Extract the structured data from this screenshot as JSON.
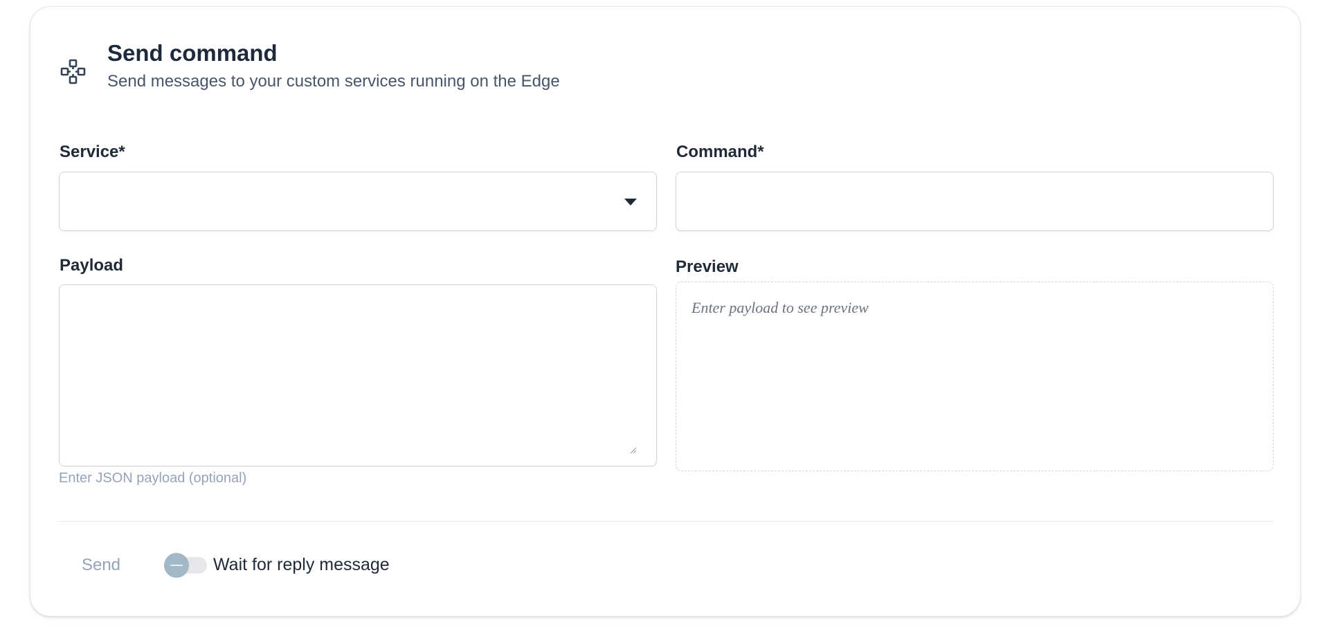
{
  "header": {
    "icon": "services-icon",
    "title": "Send command",
    "subtitle": "Send messages to your custom services running on the Edge"
  },
  "form": {
    "service": {
      "label": "Service*",
      "value": ""
    },
    "command": {
      "label": "Command*",
      "value": ""
    },
    "payload": {
      "label": "Payload",
      "value": "",
      "helper": "Enter JSON payload (optional)"
    },
    "preview": {
      "label": "Preview",
      "placeholder": "Enter payload to see preview"
    }
  },
  "footer": {
    "send_label": "Send",
    "wait_toggle": {
      "label": "Wait for reply message",
      "checked": false
    }
  }
}
